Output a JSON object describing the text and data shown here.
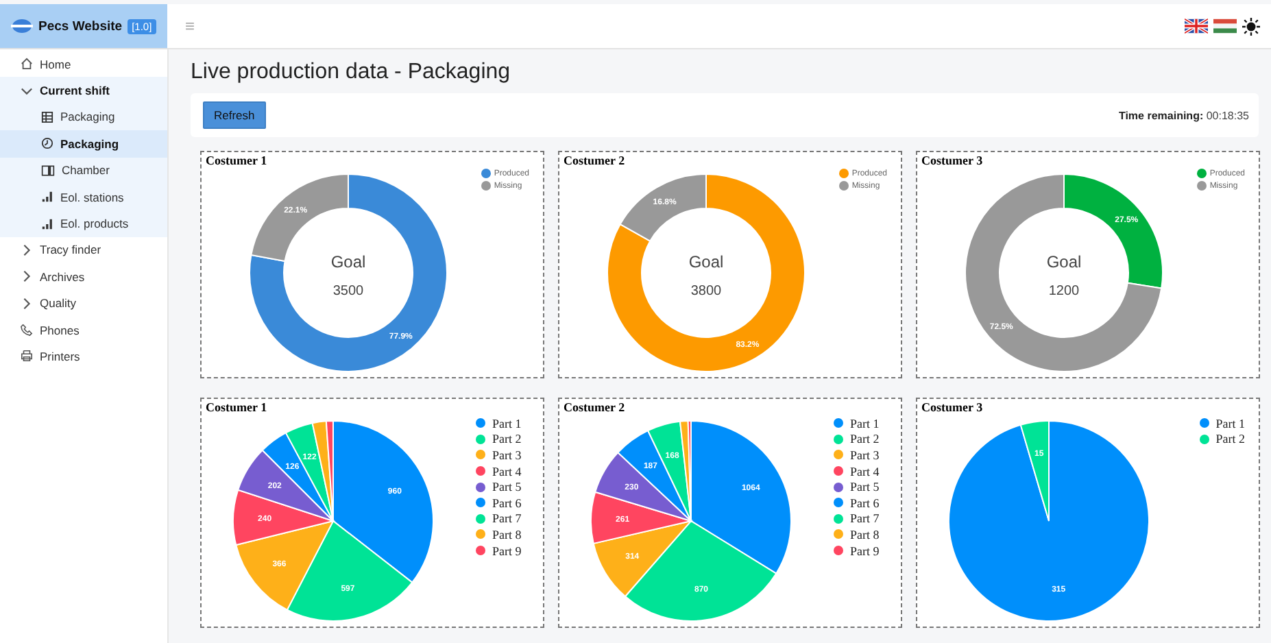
{
  "header": {
    "title": "Pecs Website",
    "version": "[1.0]",
    "menu_glyph": "≡"
  },
  "sidebar": {
    "items": [
      {
        "label": "Home",
        "selected": false
      },
      {
        "label": "Current shift",
        "selected": false,
        "expanded": true,
        "children": [
          {
            "label": "Packaging",
            "selected": false
          },
          {
            "label": "Packaging",
            "selected": true
          },
          {
            "label": "Chamber",
            "selected": false
          },
          {
            "label": "Eol. stations",
            "selected": false
          },
          {
            "label": "Eol. products",
            "selected": false
          }
        ]
      },
      {
        "label": "Tracy finder",
        "selected": false,
        "expanded": false
      },
      {
        "label": "Archives",
        "selected": false,
        "expanded": false
      },
      {
        "label": "Quality",
        "selected": false,
        "expanded": false
      },
      {
        "label": "Phones",
        "selected": false
      },
      {
        "label": "Printers",
        "selected": false
      }
    ]
  },
  "page_title": "Live production data - Packaging",
  "toolbar": {
    "button": "Refresh",
    "time_label": "Time remaining:",
    "time_value": "00:18:35"
  },
  "donut_cards": [
    {
      "center_label": "Goal",
      "center_value": "3500",
      "chart_data": {
        "type": "donut",
        "title": "Costumer 1",
        "categories": [
          "Produced",
          "Missing"
        ],
        "values": [
          77.9,
          22.1
        ],
        "colors": [
          "#3a8ad8",
          "#999999"
        ],
        "value_labels": [
          "77.9%",
          "22.1%"
        ],
        "legend": "top-right"
      }
    },
    {
      "center_label": "Goal",
      "center_value": "3800",
      "chart_data": {
        "type": "donut",
        "title": "Costumer 2",
        "categories": [
          "Produced",
          "Missing"
        ],
        "values": [
          83.2,
          16.8
        ],
        "colors": [
          "#fd9a00",
          "#999999"
        ],
        "value_labels": [
          "83.2%",
          "16.8%"
        ],
        "legend": "top-right"
      }
    },
    {
      "center_label": "Goal",
      "center_value": "1200",
      "chart_data": {
        "type": "donut",
        "title": "Costumer 3",
        "categories": [
          "Produced",
          "Missing"
        ],
        "values": [
          27.5,
          72.5
        ],
        "colors": [
          "#00b140",
          "#999999"
        ],
        "value_labels": [
          "27.5%",
          "72.5%"
        ],
        "legend": "top-right"
      }
    }
  ],
  "pie_cards": [
    {
      "chart_data": {
        "type": "pie",
        "title": "Costumer 1",
        "categories": [
          "Part 1",
          "Part 2",
          "Part 3",
          "Part 4",
          "Part 5",
          "Part 6",
          "Part 7",
          "Part 8",
          "Part 9"
        ],
        "values": [
          960,
          597,
          366,
          240,
          202,
          126,
          122,
          60,
          30
        ],
        "colors": [
          "#008ffb",
          "#00e396",
          "#feb019",
          "#ff4560",
          "#775dd0",
          "#008ffb",
          "#00e396",
          "#feb019",
          "#ff4560"
        ],
        "value_labels": [
          "960",
          "597",
          "366",
          "240",
          "202",
          "126",
          "122",
          null,
          null
        ],
        "legend": "right"
      }
    },
    {
      "chart_data": {
        "type": "pie",
        "title": "Costumer 2",
        "categories": [
          "Part 1",
          "Part 2",
          "Part 3",
          "Part 4",
          "Part 5",
          "Part 6",
          "Part 7",
          "Part 8",
          "Part 9"
        ],
        "values": [
          1064,
          870,
          314,
          261,
          230,
          187,
          168,
          40,
          15
        ],
        "colors": [
          "#008ffb",
          "#00e396",
          "#feb019",
          "#ff4560",
          "#775dd0",
          "#008ffb",
          "#00e396",
          "#feb019",
          "#ff4560"
        ],
        "value_labels": [
          "1064",
          "870",
          "314",
          "261",
          "230",
          "187",
          "168",
          null,
          null
        ],
        "legend": "right"
      }
    },
    {
      "chart_data": {
        "type": "pie",
        "title": "Costumer 3",
        "categories": [
          "Part 1",
          "Part 2"
        ],
        "values": [
          315,
          15
        ],
        "colors": [
          "#008ffb",
          "#00e396"
        ],
        "value_labels": [
          "315",
          "15"
        ],
        "legend": "top-right"
      }
    }
  ]
}
